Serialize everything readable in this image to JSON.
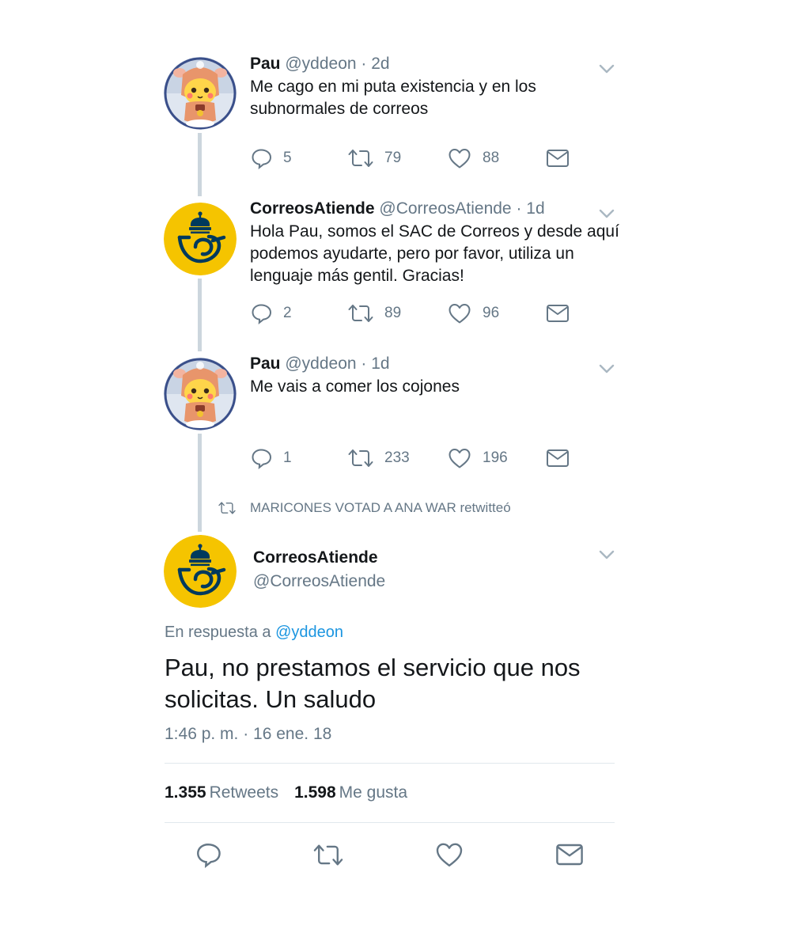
{
  "thread": [
    {
      "name": "Pau",
      "handle": "@yddeon",
      "time": "· 2d",
      "text": "Me cago en mi puta existencia y en los subnormales de correos",
      "replies": "5",
      "retweets": "79",
      "likes": "88"
    },
    {
      "name": "CorreosAtiende",
      "handle": "@CorreosAtiende",
      "time": "· 1d",
      "text": "Hola Pau, somos el SAC de Correos y desde aquí podemos ayudarte, pero por favor, utiliza un lenguaje más gentil. Gracias!",
      "replies": "2",
      "retweets": "89",
      "likes": "96"
    },
    {
      "name": "Pau",
      "handle": "@yddeon",
      "time": "· 1d",
      "text": "Me vais a comer los cojones",
      "replies": "1",
      "retweets": "233",
      "likes": "196"
    }
  ],
  "retweet_note": "MARICONES VOTAD A ANA WAR retwitteó",
  "main_tweet": {
    "name": "CorreosAtiende",
    "handle": "@CorreosAtiende",
    "reply_prefix": "En respuesta a",
    "reply_mention": "@yddeon",
    "text": "Pau, no prestamos el servicio que nos solicitas. Un saludo",
    "timestamp": "1:46 p. m. · 16 ene. 18",
    "retweet_count": "1.355",
    "retweet_label": "Retweets",
    "like_count": "1.598",
    "like_label": "Me gusta"
  },
  "icons": {
    "reply": "reply-icon",
    "retweet": "retweet-icon",
    "like": "heart-icon",
    "dm": "envelope-icon",
    "caret": "chevron-down-icon",
    "correos_logo": "correos-crown-horn-logo",
    "pau_avatar": "pikachu-costume-avatar"
  },
  "colors": {
    "text": "#14171a",
    "secondary": "#657786",
    "link": "#1b95e0",
    "thread_line": "#ccd6dd",
    "correos_yellow": "#f5c400",
    "correos_blue": "#003a5d"
  }
}
